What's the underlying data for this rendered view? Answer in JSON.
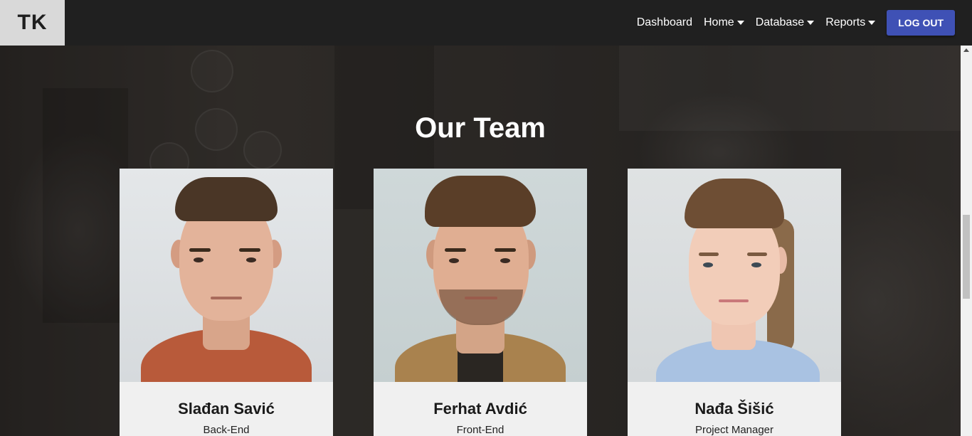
{
  "brand": {
    "logo_text": "TK"
  },
  "nav": {
    "items": [
      {
        "label": "Dashboard",
        "dropdown": false
      },
      {
        "label": "Home",
        "dropdown": true
      },
      {
        "label": "Database",
        "dropdown": true
      },
      {
        "label": "Reports",
        "dropdown": true
      }
    ],
    "logout_label": "LOG OUT"
  },
  "section": {
    "title": "Our Team"
  },
  "team": [
    {
      "name": "Slađan Savić",
      "role": "Back-End",
      "portrait": "man-orange-shirt"
    },
    {
      "name": "Ferhat Avdić",
      "role": "Front-End",
      "portrait": "man-tan-jacket"
    },
    {
      "name": "Nađa Šišić",
      "role": "Project Manager",
      "portrait": "woman-blue-shirt"
    }
  ],
  "colors": {
    "navbar": "#202020",
    "brand_bg": "#d9d9d9",
    "logout_button": "#3f51b5",
    "card_info_bg": "#f0f0f0"
  }
}
